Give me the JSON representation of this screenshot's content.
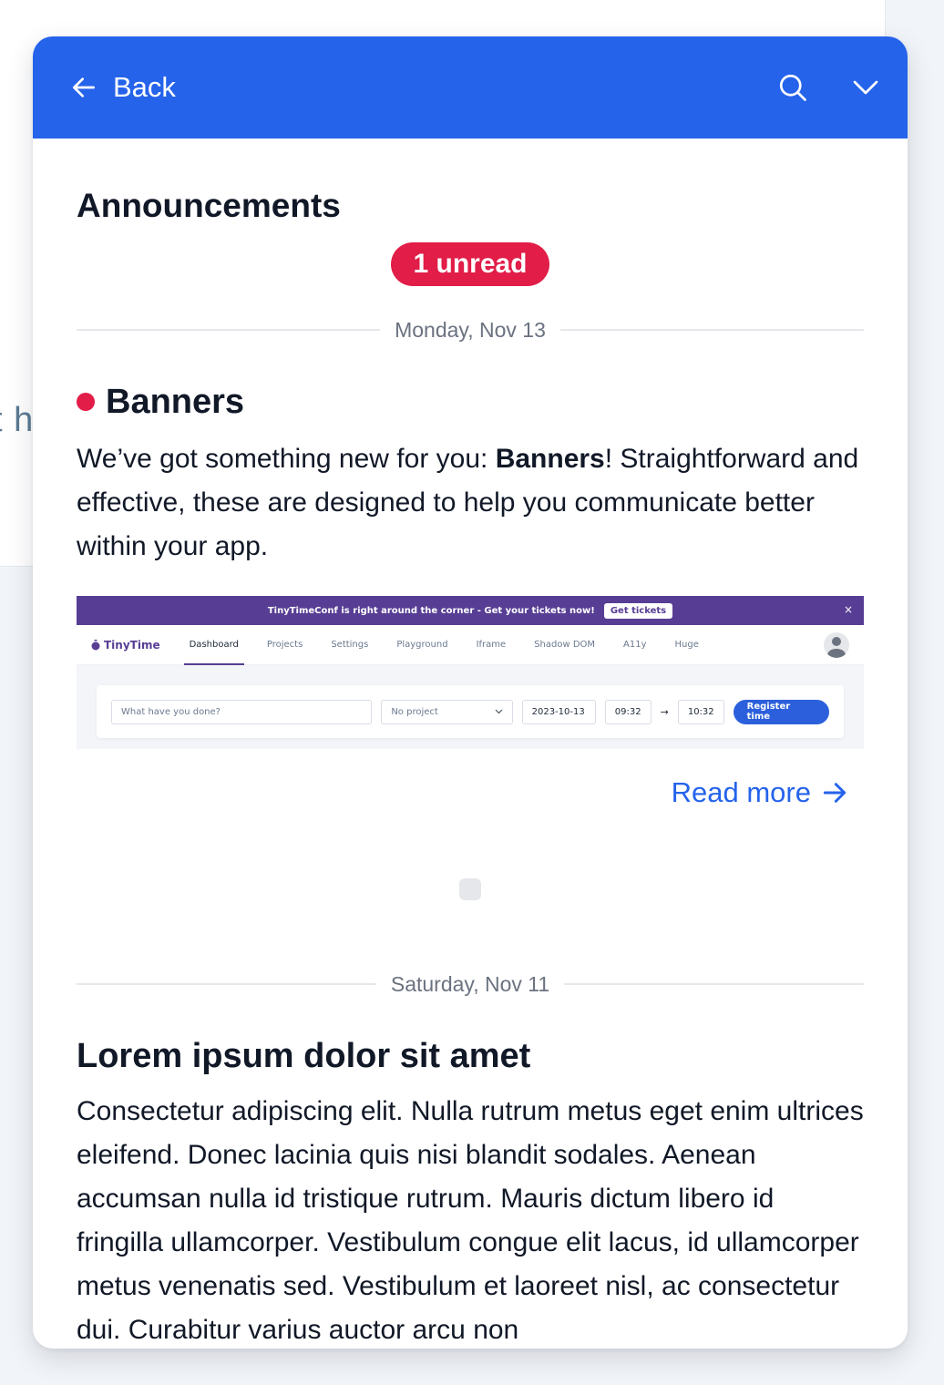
{
  "background": {
    "partial_text": "t h"
  },
  "header": {
    "back_label": "Back",
    "back_icon": "arrow-left-icon",
    "search_icon": "search-icon",
    "collapse_icon": "chevron-down-icon",
    "color": "#2563eb"
  },
  "page": {
    "title": "Announcements",
    "unread_badge": "1 unread",
    "badge_color": "#e11d48"
  },
  "announcements": [
    {
      "date": "Monday, Nov 13",
      "unread": true,
      "title": "Banners",
      "body_prefix": "We’ve got something new for you: ",
      "body_bold": "Banners",
      "body_suffix": "! Straightforward and effective, these are designed to help you communicate better within your app.",
      "preview": {
        "banner_text": "TinyTimeConf is right around the corner - Get your tickets now!",
        "banner_button": "Get tickets",
        "banner_close": "×",
        "logo": "TinyTime",
        "logo_icon": "stopwatch-icon",
        "nav_items": [
          "Dashboard",
          "Projects",
          "Settings",
          "Playground",
          "Iframe",
          "Shadow DOM",
          "A11y",
          "Huge"
        ],
        "active_nav": "Dashboard",
        "description_placeholder": "What have you done?",
        "project_select": "No project",
        "date_value": "2023-10-13",
        "start_time": "09:32",
        "end_time": "10:32",
        "arrow": "→",
        "register_button": "Register time"
      },
      "read_more": "Read more"
    },
    {
      "date": "Saturday, Nov 11",
      "unread": false,
      "title": "Lorem ipsum dolor sit amet",
      "body": "Consectetur adipiscing elit. Nulla rutrum metus eget enim ultrices eleifend. Donec lacinia quis nisi blandit sodales. Aenean accumsan nulla id tristique rutrum. Mauris dictum libero id fringilla ullamcorper. Vestibulum congue elit lacus, id ullamcorper metus venenatis sed. Vestibulum et laoreet nisl, ac consectetur dui. Curabitur varius auctor arcu non"
    }
  ]
}
